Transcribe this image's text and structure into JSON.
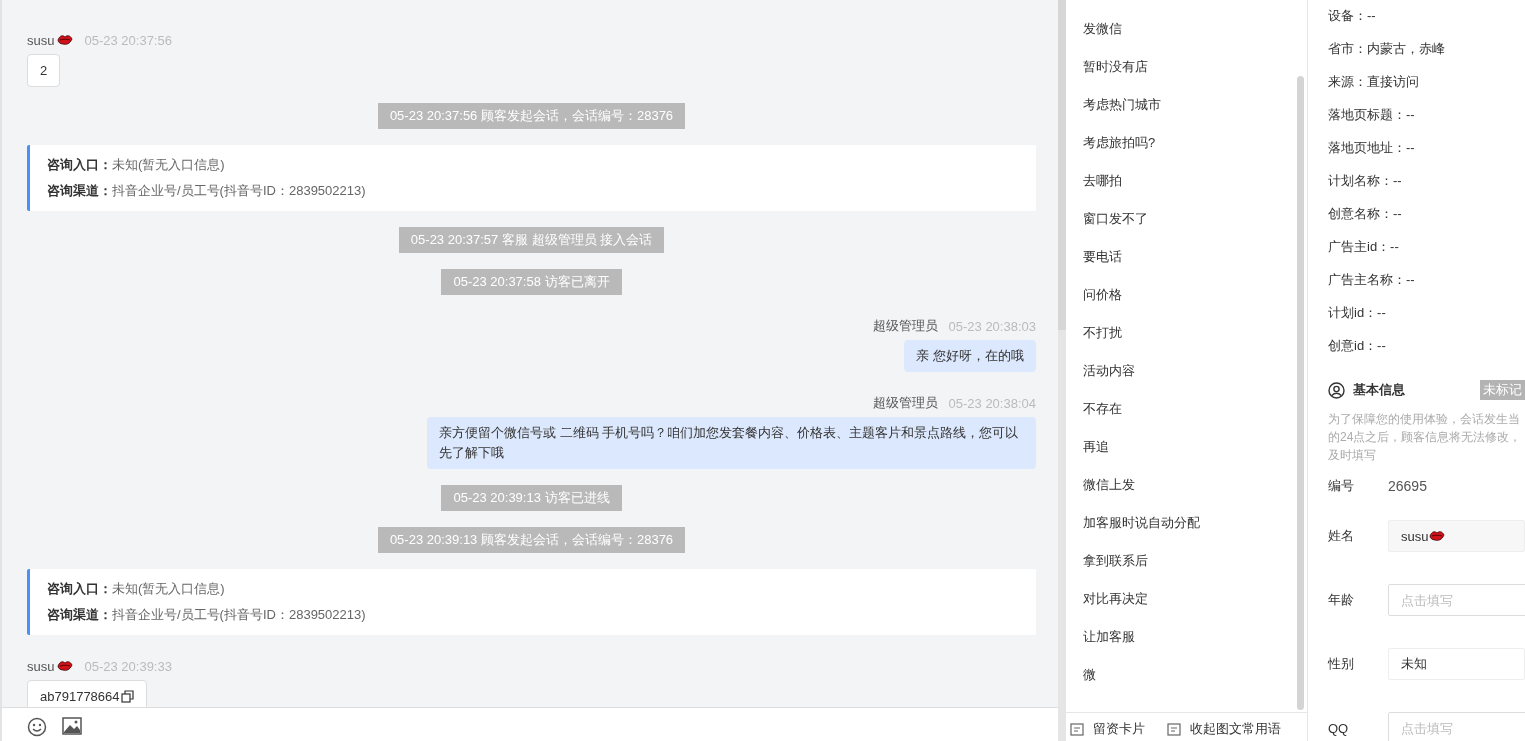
{
  "chat": {
    "messages": [
      {
        "kind": "customer",
        "name": "susu",
        "emoji": true,
        "time": "05-23 20:37:56",
        "text": "2",
        "copyable": false
      },
      {
        "kind": "system",
        "text": "05-23 20:37:56 顾客发起会话，会话编号：28376"
      },
      {
        "kind": "entry",
        "rows": [
          {
            "label": "咨询入口：",
            "value": "未知(暂无入口信息)"
          },
          {
            "label": "咨询渠道：",
            "value": "抖音企业号/员工号(抖音号ID：2839502213)"
          }
        ]
      },
      {
        "kind": "system",
        "text": "05-23 20:37:57 客服 超级管理员 接入会话"
      },
      {
        "kind": "system",
        "text": "05-23 20:37:58 访客已离开"
      },
      {
        "kind": "agent",
        "name": "超级管理员",
        "time": "05-23 20:38:03",
        "text": "亲 您好呀，在的哦"
      },
      {
        "kind": "agent",
        "name": "超级管理员",
        "time": "05-23 20:38:04",
        "text": "亲方便留个微信号或 二维码 手机号吗？咱们加您发套餐内容、价格表、主题客片和景点路线，您可以先了解下哦"
      },
      {
        "kind": "system",
        "text": "05-23 20:39:13 访客已进线"
      },
      {
        "kind": "system",
        "text": "05-23 20:39:13 顾客发起会话，会话编号：28376"
      },
      {
        "kind": "entry",
        "rows": [
          {
            "label": "咨询入口：",
            "value": "未知(暂无入口信息)"
          },
          {
            "label": "咨询渠道：",
            "value": "抖音企业号/员工号(抖音号ID：2839502213)"
          }
        ]
      },
      {
        "kind": "customer",
        "name": "susu",
        "emoji": true,
        "time": "05-23 20:39:33",
        "text": "ab791778664",
        "copyable": true
      }
    ]
  },
  "quick_replies": {
    "items": [
      "发微信",
      "暂时没有店",
      "考虑热门城市",
      "考虑旅拍吗?",
      "去哪拍",
      "窗口发不了",
      "要电话",
      "问价格",
      "不打扰",
      "活动内容",
      "不存在",
      "再追",
      "微信上发",
      "加客服时说自动分配",
      "拿到联系后",
      "对比再决定",
      "让加客服",
      "微"
    ],
    "footer": [
      "留资卡片",
      "收起图文常用语"
    ]
  },
  "visitor_info": [
    "设备：--",
    "省市：内蒙古，赤峰",
    "来源：直接访问",
    "落地页标题：--",
    "落地页地址：--",
    "计划名称：--",
    "创意名称：--",
    "广告主id：--",
    "广告主名称：--",
    "计划id：--",
    "创意id：--"
  ],
  "basic_info": {
    "title": "基本信息",
    "tag": "未标记",
    "hint_lines": [
      "为了保障您的使用体验，会话发生当",
      "的24点之后，顾客信息将无法修改，",
      "及时填写"
    ],
    "rows": [
      {
        "kind": "text",
        "label": "编号",
        "value": "26695"
      },
      {
        "kind": "filled",
        "label": "姓名",
        "value": "susu",
        "emoji": true
      },
      {
        "kind": "input",
        "label": "年龄",
        "placeholder": "点击填写"
      },
      {
        "kind": "select",
        "label": "性别",
        "value": "未知"
      },
      {
        "kind": "input",
        "label": "QQ",
        "placeholder": "点击填写"
      }
    ]
  }
}
